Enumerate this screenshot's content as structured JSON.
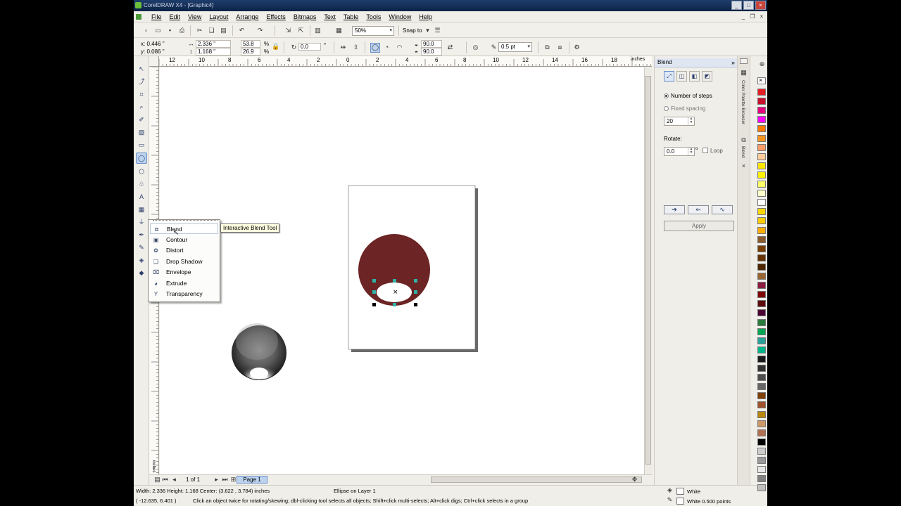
{
  "window": {
    "title": "CorelDRAW X4 - [Graphic4]",
    "buttons": [
      "_",
      "□",
      "×"
    ]
  },
  "menu": [
    "File",
    "Edit",
    "View",
    "Layout",
    "Arrange",
    "Effects",
    "Bitmaps",
    "Text",
    "Table",
    "Tools",
    "Window",
    "Help"
  ],
  "toolbar": {
    "zoom": "50%",
    "snap_to": "Snap to"
  },
  "propertybar": {
    "x": "x: 0.446 \"",
    "y": "y: 0.086 \"",
    "w": "2.336 \"",
    "h": "1.168 \"",
    "scale_x": "53.8",
    "scale_y": "26.9",
    "pct": "%",
    "rotation": "0.0",
    "degree": "°",
    "angle1": "90.0",
    "angle2": "90.0",
    "outline": "0.5 pt"
  },
  "ruler": {
    "h_ticks": [
      "12",
      "10",
      "8",
      "6",
      "4",
      "2",
      "0",
      "2",
      "4",
      "6",
      "8",
      "10",
      "12",
      "14",
      "16",
      "18",
      "inches"
    ],
    "v_ticks": [
      "18",
      "16",
      "14",
      "12",
      "10",
      "8",
      "6",
      "4",
      "2",
      "0",
      "2",
      "4",
      "6",
      "8",
      "10",
      "12"
    ],
    "v_unit": "inches"
  },
  "flyout": {
    "items": [
      {
        "label": "Blend",
        "icon": "blend-icon"
      },
      {
        "label": "Contour",
        "icon": "contour-icon"
      },
      {
        "label": "Distort",
        "icon": "distort-icon"
      },
      {
        "label": "Drop Shadow",
        "icon": "drop-shadow-icon"
      },
      {
        "label": "Envelope",
        "icon": "envelope-icon"
      },
      {
        "label": "Extrude",
        "icon": "extrude-icon"
      },
      {
        "label": "Transparency",
        "icon": "transparency-icon"
      }
    ]
  },
  "tooltip": "Interactive Blend Tool",
  "colors": {
    "ellipse_fill": "#6c2424",
    "handle": "#2fb2a8",
    "titlebar": "#0c2246"
  },
  "pager": {
    "count": "1 of 1",
    "page_tab": "Page 1"
  },
  "docker": {
    "title": "Blend",
    "number_of_steps": "Number of steps",
    "fixed_spacing": "Fixed spacing",
    "steps_value": "20",
    "rotate_label": "Rotate:",
    "rotate_value": "0.0",
    "degree": "o",
    "loop": "Loop",
    "apply": "Apply",
    "side_tab_palette": "Color Palette Browser",
    "side_tab_blend": "Blend"
  },
  "status": {
    "dims": "Width: 2.336  Height: 1.168  Center: (3.622 , 3.784)  inches",
    "object": "Ellipse on Layer 1",
    "cursor": "( -12.635, 6.401 )",
    "hint": "Click an object twice for rotating/skewing; dbl-clicking tool selects all objects; Shift+click multi-selects; Alt+click digs; Ctrl+click selects in a group",
    "fill": "White",
    "outline": "White  0.500 points"
  }
}
